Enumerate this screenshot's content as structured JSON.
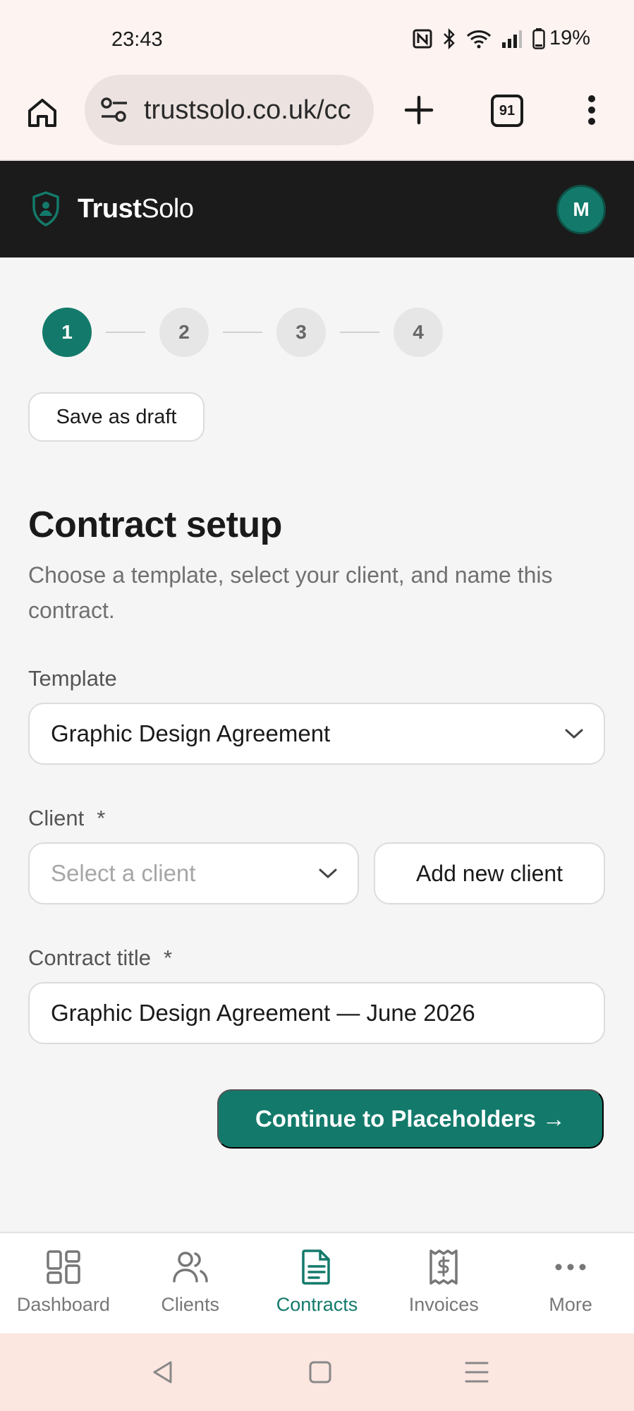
{
  "status_bar": {
    "time": "23:43",
    "battery": "19%"
  },
  "browser": {
    "url": "trustsolo.co.uk/cc",
    "tab_count": "91"
  },
  "header": {
    "brand_bold": "Trust",
    "brand_regular": "Solo",
    "avatar_initial": "M"
  },
  "stepper": {
    "steps": [
      "1",
      "2",
      "3",
      "4"
    ],
    "active_step": 1
  },
  "toolbar": {
    "save_draft_label": "Save as draft"
  },
  "page": {
    "title": "Contract setup",
    "subtitle": "Choose a template, select your client, and name this contract."
  },
  "form": {
    "template_label": "Template",
    "template_value": "Graphic Design Agreement",
    "client_label": "Client",
    "client_required": "*",
    "client_placeholder": "Select a client",
    "add_client_label": "Add new client",
    "title_label": "Contract title",
    "title_required": "*",
    "title_value": "Graphic Design Agreement — June 2026",
    "continue_label": "Continue to Placeholders →"
  },
  "bottom_nav": {
    "items": [
      {
        "label": "Dashboard",
        "icon": "dashboard-icon"
      },
      {
        "label": "Clients",
        "icon": "users-icon"
      },
      {
        "label": "Contracts",
        "icon": "document-icon"
      },
      {
        "label": "Invoices",
        "icon": "receipt-icon"
      },
      {
        "label": "More",
        "icon": "more-icon"
      }
    ],
    "active": "Contracts"
  },
  "colors": {
    "accent": "#137a6b",
    "header_bg": "#1b1b1b",
    "page_bg": "#f5f5f5"
  }
}
